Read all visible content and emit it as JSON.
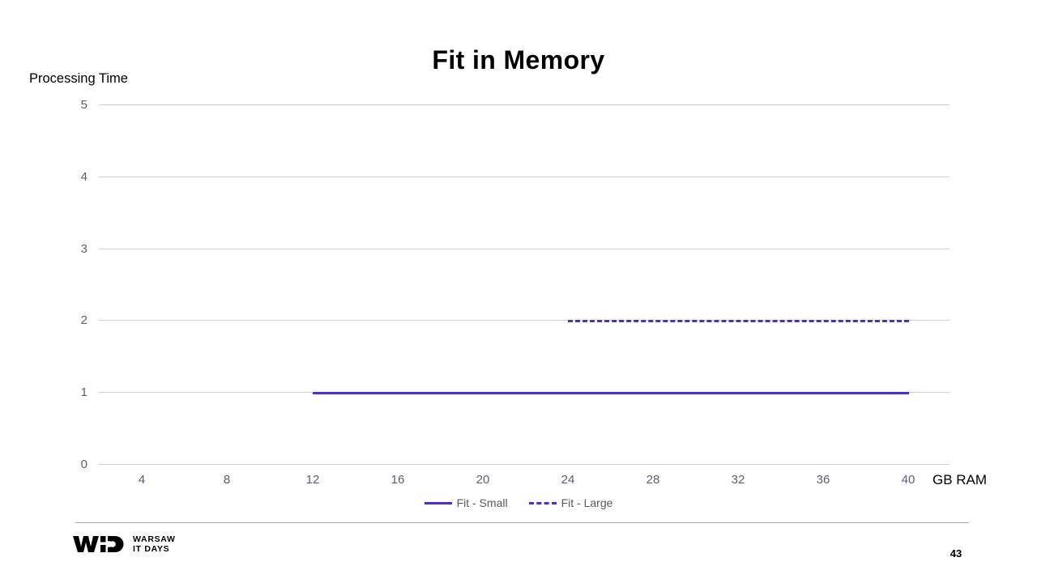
{
  "slide": {
    "title": "Fit in Memory",
    "page_number": "43"
  },
  "footer": {
    "logo_mark": "wid-logo-icon",
    "logo_line1": "WARSAW",
    "logo_line2": "IT DAYS"
  },
  "chart_data": {
    "type": "line",
    "title": "Fit in Memory",
    "xlabel": "GB RAM",
    "ylabel": "Processing Time",
    "xlim": [
      0,
      42
    ],
    "ylim": [
      0,
      5
    ],
    "xticks": [
      "4",
      "8",
      "12",
      "16",
      "20",
      "24",
      "28",
      "32",
      "36",
      "40"
    ],
    "xtick_values": [
      4,
      8,
      12,
      16,
      20,
      24,
      28,
      32,
      36,
      40
    ],
    "yticks": [
      "0",
      "1",
      "2",
      "3",
      "4",
      "5"
    ],
    "ytick_values": [
      0,
      1,
      2,
      3,
      4,
      5
    ],
    "grid": true,
    "legend_position": "bottom",
    "accent_color": "#4b2fd4",
    "gridline_color": "#cfcfcf",
    "tick_label_color": "#5c5b78",
    "series": [
      {
        "name": "Fit - Small",
        "style": "solid",
        "color": "#4b2fd4",
        "x": [
          12,
          16,
          20,
          24,
          28,
          32,
          36,
          40
        ],
        "values": [
          1,
          1,
          1,
          1,
          1,
          1,
          1,
          1
        ]
      },
      {
        "name": "Fit - Large",
        "style": "dashed",
        "color": "#4b2fd4",
        "x": [
          24,
          28,
          32,
          36,
          40
        ],
        "values": [
          2,
          2,
          2,
          2,
          2
        ]
      }
    ]
  }
}
